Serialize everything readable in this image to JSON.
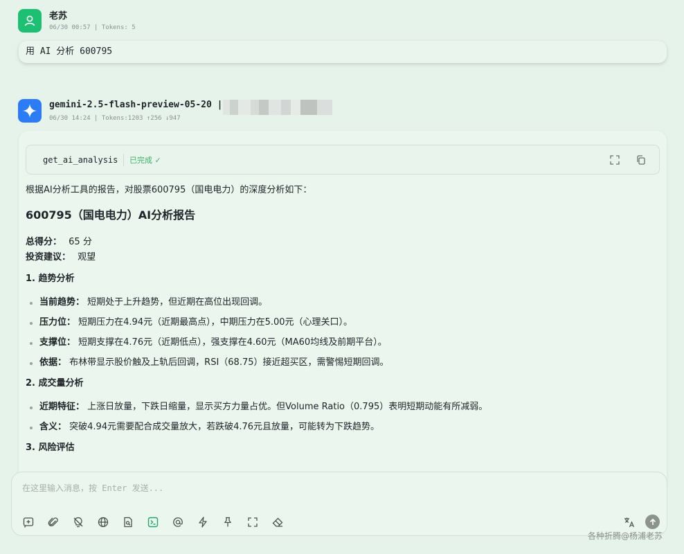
{
  "user_msg": {
    "name": "老苏",
    "meta": "06/30 00:57 | Tokens: 5",
    "text": "用 AI 分析 600795"
  },
  "ai_msg": {
    "name": "gemini-2.5-flash-preview-05-20 |",
    "meta": "06/30 14:24 | Tokens:1203 ↑256 ↓947",
    "tool": {
      "name": "get_ai_analysis",
      "status": "已完成 ✓"
    },
    "intro": "根据AI分析工具的报告，对股票600795（国电电力）的深度分析如下：",
    "title": "600795（国电电力）AI分析报告",
    "score_label": "总得分：",
    "score_value": "65 分",
    "advice_label": "投资建议：",
    "advice_value": "观望",
    "sections": [
      {
        "heading": "1. 趋势分析",
        "items": [
          {
            "label": "当前趋势：",
            "text": "短期处于上升趋势，但近期在高位出现回调。"
          },
          {
            "label": "压力位：",
            "text": "短期压力在4.94元（近期最高点），中期压力在5.00元（心理关口）。"
          },
          {
            "label": "支撑位：",
            "text": "短期支撑在4.76元（近期低点），强支撑在4.60元（MA60均线及前期平台）。"
          },
          {
            "label": "依据：",
            "text": "布林带显示股价触及上轨后回调，RSI（68.75）接近超买区，需警惕短期回调。"
          }
        ]
      },
      {
        "heading": "2. 成交量分析",
        "items": [
          {
            "label": "近期特征：",
            "text": "上涨日放量，下跌日缩量，显示买方力量占优。但Volume Ratio（0.795）表明短期动能有所减弱。"
          },
          {
            "label": "含义：",
            "text": "突破4.94元需要配合成交量放大，若跌破4.76元且放量，可能转为下跌趋势。"
          }
        ]
      },
      {
        "heading": "3. 风险评估",
        "items": []
      }
    ]
  },
  "input": {
    "placeholder": "在这里输入消息，按 Enter 发送..."
  },
  "toolbar_icons": [
    "new-topic-icon",
    "attachment-icon",
    "lightbulb-icon",
    "globe-icon",
    "knowledge-icon",
    "terminal-icon",
    "mention-icon",
    "lightning-icon",
    "pin-icon",
    "fullscreen-icon",
    "eraser-icon"
  ],
  "watermark": "各种折腾@杨浦老苏",
  "colors": {
    "background": "#e6f3ea",
    "user_avatar": "#1dbf73",
    "ai_avatar": "#2b7cf6",
    "status": "#3fb26b"
  }
}
